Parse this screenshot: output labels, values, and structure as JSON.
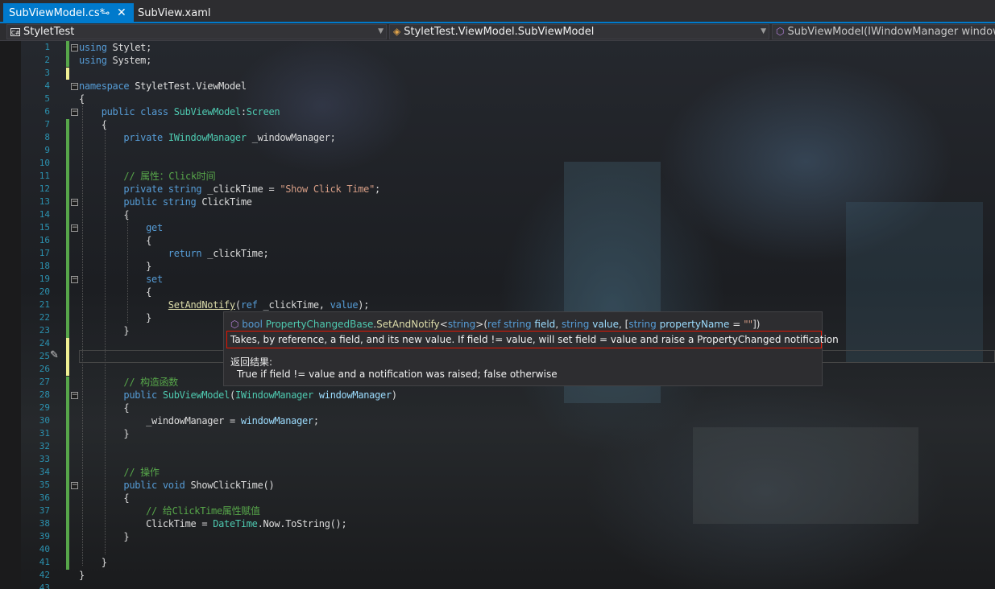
{
  "tabs": [
    {
      "label": "SubViewModel.cs*",
      "active": true,
      "pin_glyph": "⊸",
      "close_glyph": "✕"
    },
    {
      "label": "SubView.xaml",
      "active": false
    }
  ],
  "navbar": {
    "project": "StyletTest",
    "type": "StyletTest.ViewModel.SubViewModel",
    "member": "SubViewModel(IWindowManager windowManager)"
  },
  "editor": {
    "line_numbers": [
      "1",
      "2",
      "3",
      "4",
      "5",
      "6",
      "7",
      "8",
      "9",
      "10",
      "11",
      "12",
      "13",
      "14",
      "15",
      "16",
      "17",
      "18",
      "19",
      "20",
      "21",
      "22",
      "23",
      "24",
      "25",
      "26",
      "27",
      "28",
      "29",
      "30",
      "31",
      "32",
      "33",
      "34",
      "35",
      "36",
      "37",
      "38",
      "39",
      "40",
      "41",
      "42",
      "43"
    ],
    "lines": [
      [
        {
          "c": "kw",
          "t": "using"
        },
        {
          "c": "",
          "t": " Stylet;"
        }
      ],
      [
        {
          "c": "kw",
          "t": "using"
        },
        {
          "c": "",
          "t": " System;"
        }
      ],
      [],
      [
        {
          "c": "kw",
          "t": "namespace"
        },
        {
          "c": "",
          "t": " StyletTest.ViewModel"
        }
      ],
      [
        {
          "c": "",
          "t": "{"
        }
      ],
      [
        {
          "c": "",
          "t": "    "
        },
        {
          "c": "kw",
          "t": "public class"
        },
        {
          "c": "",
          "t": " "
        },
        {
          "c": "ty",
          "t": "SubViewModel"
        },
        {
          "c": "",
          "t": ":"
        },
        {
          "c": "ty",
          "t": "Screen"
        }
      ],
      [
        {
          "c": "",
          "t": "    {"
        }
      ],
      [
        {
          "c": "",
          "t": "        "
        },
        {
          "c": "kw",
          "t": "private"
        },
        {
          "c": "",
          "t": " "
        },
        {
          "c": "ty",
          "t": "IWindowManager"
        },
        {
          "c": "",
          "t": " _windowManager;"
        }
      ],
      [],
      [],
      [
        {
          "c": "",
          "t": "        "
        },
        {
          "c": "cm",
          "t": "// 属性：Click时间"
        }
      ],
      [
        {
          "c": "",
          "t": "        "
        },
        {
          "c": "kw",
          "t": "private string"
        },
        {
          "c": "",
          "t": " _clickTime = "
        },
        {
          "c": "st",
          "t": "\"Show Click Time\""
        },
        {
          "c": "",
          "t": ";"
        }
      ],
      [
        {
          "c": "",
          "t": "        "
        },
        {
          "c": "kw",
          "t": "public string"
        },
        {
          "c": "",
          "t": " ClickTime"
        }
      ],
      [
        {
          "c": "",
          "t": "        {"
        }
      ],
      [
        {
          "c": "",
          "t": "            "
        },
        {
          "c": "kw",
          "t": "get"
        }
      ],
      [
        {
          "c": "",
          "t": "            {"
        }
      ],
      [
        {
          "c": "",
          "t": "                "
        },
        {
          "c": "kw",
          "t": "return"
        },
        {
          "c": "",
          "t": " _clickTime;"
        }
      ],
      [
        {
          "c": "",
          "t": "            }"
        }
      ],
      [
        {
          "c": "",
          "t": "            "
        },
        {
          "c": "kw",
          "t": "set"
        }
      ],
      [
        {
          "c": "",
          "t": "            {"
        }
      ],
      [
        {
          "c": "",
          "t": "                "
        },
        {
          "c": "fn u",
          "t": "SetAndNotify"
        },
        {
          "c": "",
          "t": "("
        },
        {
          "c": "kw",
          "t": "ref"
        },
        {
          "c": "",
          "t": " _clickTime, "
        },
        {
          "c": "kw",
          "t": "value"
        },
        {
          "c": "",
          "t": ");"
        }
      ],
      [
        {
          "c": "",
          "t": "            }"
        }
      ],
      [
        {
          "c": "",
          "t": "        }"
        }
      ],
      [],
      [],
      [],
      [
        {
          "c": "",
          "t": "        "
        },
        {
          "c": "cm",
          "t": "// 构造函数"
        }
      ],
      [
        {
          "c": "",
          "t": "        "
        },
        {
          "c": "kw",
          "t": "public"
        },
        {
          "c": "",
          "t": " "
        },
        {
          "c": "ty",
          "t": "SubViewModel"
        },
        {
          "c": "",
          "t": "("
        },
        {
          "c": "ty",
          "t": "IWindowManager"
        },
        {
          "c": "",
          "t": " "
        },
        {
          "c": "pa",
          "t": "windowManager"
        },
        {
          "c": "",
          "t": ")"
        }
      ],
      [
        {
          "c": "",
          "t": "        {"
        }
      ],
      [
        {
          "c": "",
          "t": "            _windowManager = "
        },
        {
          "c": "pa",
          "t": "windowManager"
        },
        {
          "c": "",
          "t": ";"
        }
      ],
      [
        {
          "c": "",
          "t": "        }"
        }
      ],
      [],
      [],
      [
        {
          "c": "",
          "t": "        "
        },
        {
          "c": "cm",
          "t": "// 操作"
        }
      ],
      [
        {
          "c": "",
          "t": "        "
        },
        {
          "c": "kw",
          "t": "public void"
        },
        {
          "c": "",
          "t": " ShowClickTime()"
        }
      ],
      [
        {
          "c": "",
          "t": "        {"
        }
      ],
      [
        {
          "c": "",
          "t": "            "
        },
        {
          "c": "cm",
          "t": "// 给ClickTime属性赋值"
        }
      ],
      [
        {
          "c": "",
          "t": "            ClickTime = "
        },
        {
          "c": "ty",
          "t": "DateTime"
        },
        {
          "c": "",
          "t": ".Now.ToString();"
        }
      ],
      [
        {
          "c": "",
          "t": "        }"
        }
      ],
      [],
      [
        {
          "c": "",
          "t": "    }"
        }
      ],
      [
        {
          "c": "",
          "t": "}"
        }
      ],
      []
    ]
  },
  "tooltip": {
    "signature": [
      {
        "c": "kw",
        "t": "bool"
      },
      {
        "c": "",
        "t": " "
      },
      {
        "c": "ty",
        "t": "PropertyChangedBase"
      },
      {
        "c": "",
        "t": "."
      },
      {
        "c": "fn",
        "t": "SetAndNotify"
      },
      {
        "c": "",
        "t": "<"
      },
      {
        "c": "kw",
        "t": "string"
      },
      {
        "c": "",
        "t": ">("
      },
      {
        "c": "kw",
        "t": "ref string"
      },
      {
        "c": "",
        "t": " "
      },
      {
        "c": "pa",
        "t": "field"
      },
      {
        "c": "",
        "t": ", "
      },
      {
        "c": "kw",
        "t": "string"
      },
      {
        "c": "",
        "t": " "
      },
      {
        "c": "pa",
        "t": "value"
      },
      {
        "c": "",
        "t": ", ["
      },
      {
        "c": "kw",
        "t": "string"
      },
      {
        "c": "",
        "t": " "
      },
      {
        "c": "pa",
        "t": "propertyName"
      },
      {
        "c": "",
        "t": " = "
      },
      {
        "c": "st",
        "t": "\"\""
      },
      {
        "c": "",
        "t": "])"
      }
    ],
    "description": "Takes, by reference, a field, and its new value. If field != value, will set field = value and raise a PropertyChanged notification",
    "returns_heading": "返回结果:",
    "returns_text": "True if field != value and a notification was raised; false otherwise"
  },
  "colors": {
    "accent": "#007acc",
    "highlight_border": "#e51400",
    "change_saved": "#57a64a",
    "change_unsaved": "#efef93",
    "keyword": "#569cd6",
    "type": "#4ec9b0",
    "string": "#d69d85",
    "comment": "#57a64a"
  }
}
